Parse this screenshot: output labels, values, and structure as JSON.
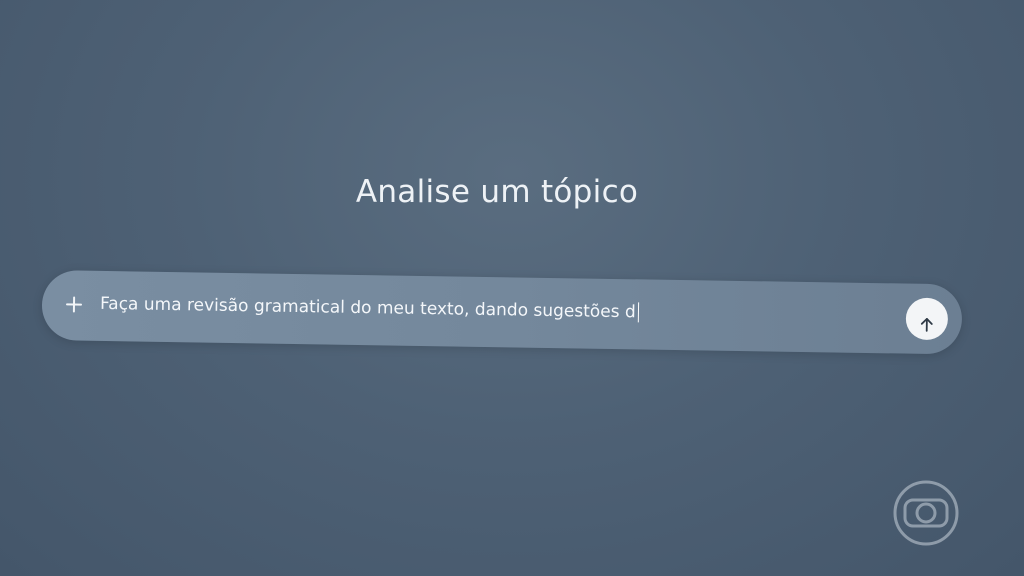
{
  "main": {
    "title": "Analise um tópico",
    "prompt_text": "Faça uma revisão gramatical do meu texto, dando sugestões d"
  },
  "icons": {
    "attach": "plus-icon",
    "send": "arrow-up-icon",
    "watermark": "broadcaster-logo"
  },
  "colors": {
    "background": "#4e6175",
    "prompt_bar": "#74889c",
    "send_button": "#f3f5f7",
    "text": "#eef2f6"
  }
}
